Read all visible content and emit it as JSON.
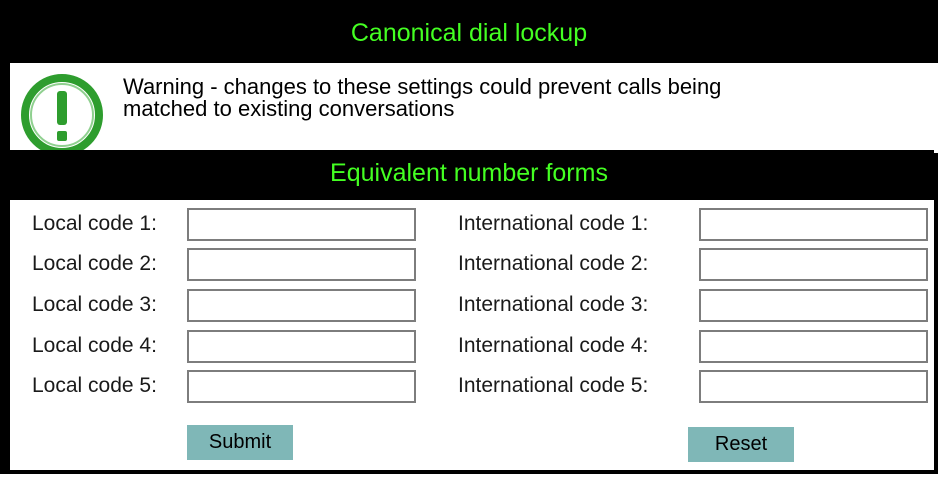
{
  "header": {
    "title": "Canonical dial lockup"
  },
  "warning": {
    "icon": "exclamation-warning-icon",
    "icon_color": "#2e9d2e",
    "line1": "Warning - changes to these settings could prevent calls being",
    "line2": "matched to existing conversations"
  },
  "section": {
    "title": "Equivalent number forms"
  },
  "local_codes": [
    {
      "label": "Local code 1:",
      "value": ""
    },
    {
      "label": "Local code 2:",
      "value": ""
    },
    {
      "label": "Local code 3:",
      "value": ""
    },
    {
      "label": "Local code 4:",
      "value": ""
    },
    {
      "label": "Local code 5:",
      "value": ""
    }
  ],
  "international_codes": [
    {
      "label": "International code 1:",
      "value": ""
    },
    {
      "label": "International code 2:",
      "value": ""
    },
    {
      "label": "International code 3:",
      "value": ""
    },
    {
      "label": "International code 4:",
      "value": ""
    },
    {
      "label": "International code 5:",
      "value": ""
    }
  ],
  "buttons": {
    "submit": "Submit",
    "reset": "Reset"
  },
  "colors": {
    "title_text": "#44ff22",
    "button_bg": "#7fb7b7",
    "frame": "#000000"
  }
}
